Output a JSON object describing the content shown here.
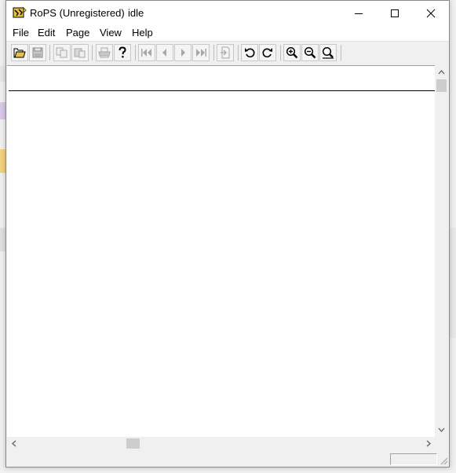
{
  "window": {
    "title": "RoPS (Unregistered)",
    "status": "idle"
  },
  "menu": {
    "items": [
      "File",
      "Edit",
      "Page",
      "View",
      "Help"
    ]
  },
  "toolbar": {
    "buttons": [
      {
        "icon": "open-folder-icon",
        "enabled": true
      },
      {
        "icon": "save-disk-icon",
        "enabled": false
      },
      {
        "icon": "copy-icon",
        "enabled": false
      },
      {
        "icon": "paste-icon",
        "enabled": false
      },
      {
        "icon": "print-icon",
        "enabled": false
      },
      {
        "icon": "help-question-icon",
        "enabled": true
      },
      {
        "icon": "first-page-icon",
        "enabled": false
      },
      {
        "icon": "previous-page-icon",
        "enabled": false
      },
      {
        "icon": "next-page-icon",
        "enabled": false
      },
      {
        "icon": "last-page-icon",
        "enabled": false
      },
      {
        "icon": "goto-page-icon",
        "enabled": false
      },
      {
        "icon": "rotate-left-icon",
        "enabled": true
      },
      {
        "icon": "rotate-right-icon",
        "enabled": true
      },
      {
        "icon": "zoom-in-icon",
        "enabled": true
      },
      {
        "icon": "zoom-out-icon",
        "enabled": true
      },
      {
        "icon": "zoom-fit-icon",
        "enabled": true
      }
    ]
  },
  "colors": {
    "title_bg": "#ffffff",
    "chrome": "#f0f0f0",
    "disabled_icon": "#a8a8a8",
    "enabled_icon": "#000000",
    "folder_yellow": "#e8c040"
  }
}
